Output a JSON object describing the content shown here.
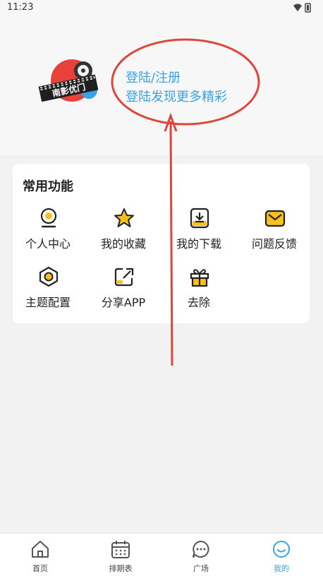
{
  "status": {
    "time": "11:23"
  },
  "profile": {
    "logo_text": "南影优门",
    "login_label": "登陆/注册",
    "login_subtitle": "登陆发现更多精彩"
  },
  "functions": {
    "title": "常用功能",
    "items": [
      {
        "label": "个人中心",
        "icon": "person-icon"
      },
      {
        "label": "我的收藏",
        "icon": "star-icon"
      },
      {
        "label": "我的下载",
        "icon": "download-icon"
      },
      {
        "label": "问题反馈",
        "icon": "mail-icon"
      },
      {
        "label": "主题配置",
        "icon": "theme-hexagon-icon"
      },
      {
        "label": "分享APP",
        "icon": "share-icon"
      },
      {
        "label": "去除",
        "icon": "gift-icon"
      }
    ]
  },
  "tabbar": {
    "active_index": 3,
    "items": [
      {
        "label": "首页",
        "icon": "home-icon"
      },
      {
        "label": "排期表",
        "icon": "calendar-icon"
      },
      {
        "label": "广场",
        "icon": "chat-icon"
      },
      {
        "label": "我的",
        "icon": "smile-icon"
      }
    ]
  },
  "colors": {
    "accent": "#3aa3e3",
    "icon_yellow": "#f5c020",
    "annotation_red": "#e0453a",
    "page_bg": "#f2f2f2"
  }
}
